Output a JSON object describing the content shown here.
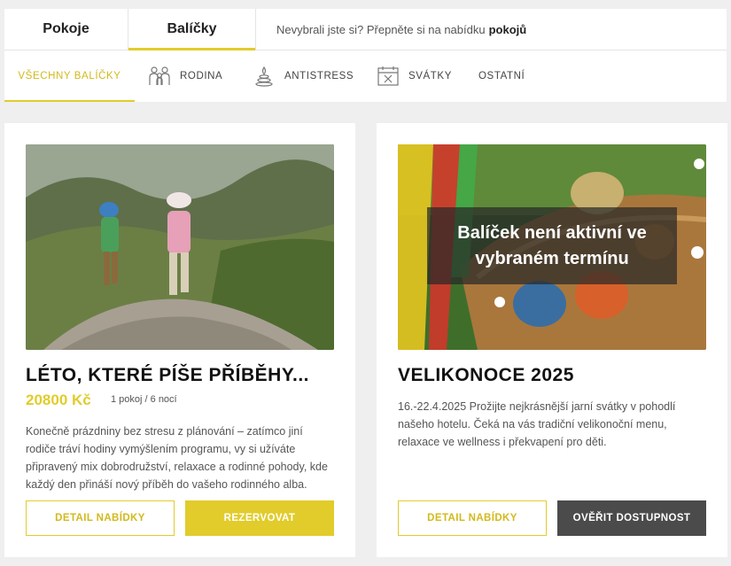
{
  "tabs": {
    "rooms_label": "Pokoje",
    "packages_label": "Balíčky",
    "note_text": "Nevybrali jste si? Přepněte si na nabídku",
    "note_link": "pokojů"
  },
  "categories": [
    {
      "label": "Všechny balíčky",
      "icon": "none"
    },
    {
      "label": "Rodina",
      "icon": "family-icon"
    },
    {
      "label": "Antistress",
      "icon": "spa-stones-icon"
    },
    {
      "label": "Svátky",
      "icon": "calendar-icon"
    },
    {
      "label": "Ostatní",
      "icon": "none"
    }
  ],
  "colors": {
    "accent": "#e1cc2b",
    "dark_button": "#4b4b4b"
  },
  "cards": [
    {
      "title": "LÉTO, KTERÉ PÍŠE PŘÍBĚHY...",
      "price": "20800 Kč",
      "meta": "1 pokoj / 6 nocí",
      "description": "Konečně prázdniny bez stresu z plánování – zatímco jiní rodiče tráví hodiny vymýšlením programu, vy si užíváte připravený mix dobrodružství, relaxace a rodinné pohody, kde každý den přináší nový příběh do vašeho rodinného alba.",
      "detail_button": "Detail nabídky",
      "action_button": "Rezervovat"
    },
    {
      "title": "VELIKONOCE 2025",
      "overlay": "Balíček není aktivní ve vybraném termínu",
      "description": "16.-22.4.2025 Prožijte nejkrásnější jarní svátky v pohodlí našeho hotelu. Čeká na vás tradiční velikonoční menu, relaxace ve wellness i překvapení pro děti.",
      "detail_button": "Detail nabídky",
      "action_button": "Ověřit dostupnost"
    }
  ]
}
